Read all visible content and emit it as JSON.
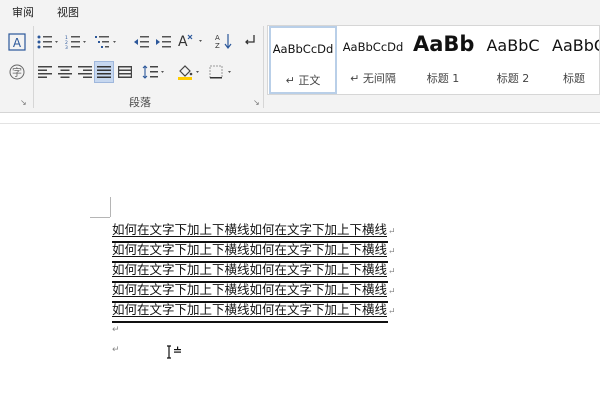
{
  "tabs": [
    "审阅",
    "视图"
  ],
  "ribbon": {
    "paragraph_group_label": "段落",
    "launcher_glyph": "↘"
  },
  "styles": [
    {
      "preview": "AaBbCcDd",
      "name": "↵ 正文",
      "selected": true
    },
    {
      "preview": "AaBbCcDd",
      "name": "↵ 无间隔",
      "selected": false
    },
    {
      "preview": "AaBb",
      "name": "标题 1",
      "selected": false
    },
    {
      "preview": "AaBbC",
      "name": "标题 2",
      "selected": false
    },
    {
      "preview": "AaBbC",
      "name": "标题",
      "selected": false
    }
  ],
  "document": {
    "lines": [
      "如何在文字下加上下横线如何在文字下加上下横线",
      "如何在文字下加上下横线如何在文字下加上下横线",
      "如何在文字下加上下横线如何在文字下加上下横线",
      "如何在文字下加上下横线如何在文字下加上下横线",
      "如何在文字下加上下横线如何在文字下加上下横线"
    ],
    "paragraph_mark": "↵"
  },
  "colors": {
    "ribbon_bg": "#f3f3f3",
    "selected_button": "#c6d7ef",
    "style_selected_border": "#b9cfe8"
  }
}
